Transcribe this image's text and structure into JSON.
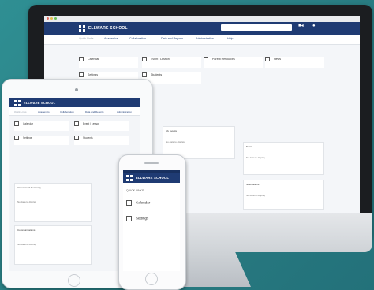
{
  "brand": {
    "school_name": "ELLWARE SCHOOL",
    "header_color": "#1f3b73",
    "accent": "#2f8f93"
  },
  "desktop": {
    "nav": [
      "Quick Links",
      "Academics",
      "Collaboration",
      "Data and Reports",
      "Administration",
      "Help"
    ],
    "search_placeholder": "",
    "tiles": [
      {
        "label": "Calendar"
      },
      {
        "label": "Event / Lesson"
      },
      {
        "label": "Parent Resources"
      },
      {
        "label": "News"
      },
      {
        "label": "Settings"
      },
      {
        "label": "Students"
      }
    ],
    "panels": [
      {
        "title": "My Events",
        "text": "No data to display"
      },
      {
        "title": "News",
        "text": "No data to display"
      },
      {
        "title": "Notifications",
        "text": "No data to display"
      }
    ]
  },
  "tablet": {
    "nav": [
      "Quick Links",
      "Academics",
      "Collaboration",
      "Data and Reports",
      "Administration"
    ],
    "tiles": [
      {
        "label": "Calendar"
      },
      {
        "label": "Event / Lesson"
      },
      {
        "label": "Settings"
      },
      {
        "label": "Students"
      }
    ],
    "panels": [
      {
        "title": "Assessment Summary",
        "text": "No data to display"
      },
      {
        "title": "Communications",
        "text": "No data to display"
      }
    ]
  },
  "phone": {
    "quick_links": "QUICK LINKS",
    "items": [
      {
        "label": "Calendar"
      },
      {
        "label": "Settings"
      }
    ]
  },
  "icons": [
    "grid-icon",
    "video-icon",
    "user-icon",
    "apple-logo"
  ]
}
